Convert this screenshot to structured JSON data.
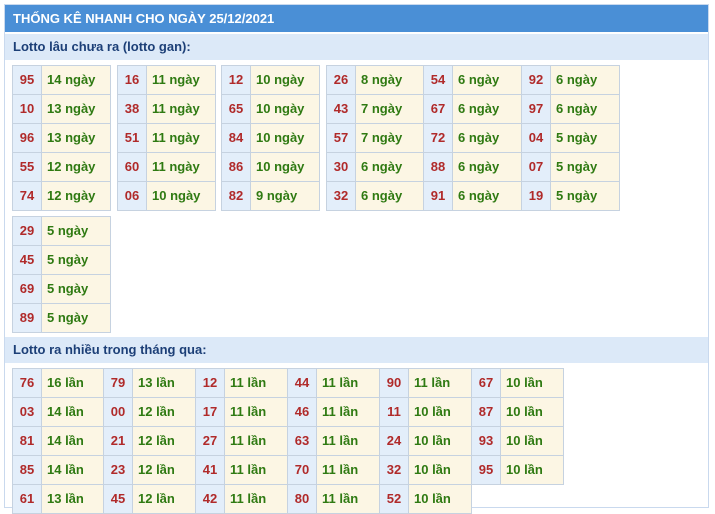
{
  "title": "THỐNG KÊ NHANH CHO NGÀY 25/12/2021",
  "sections": [
    {
      "heading": "Lotto lâu chưa ra (lotto gan):",
      "groups": [
        [
          {
            "n": "95",
            "v": "14 ngày"
          },
          {
            "n": "10",
            "v": "13 ngày"
          },
          {
            "n": "96",
            "v": "13 ngày"
          },
          {
            "n": "55",
            "v": "12 ngày"
          },
          {
            "n": "74",
            "v": "12 ngày"
          }
        ],
        [
          {
            "n": "16",
            "v": "11 ngày"
          },
          {
            "n": "38",
            "v": "11 ngày"
          },
          {
            "n": "51",
            "v": "11 ngày"
          },
          {
            "n": "60",
            "v": "11 ngày"
          },
          {
            "n": "06",
            "v": "10 ngày"
          }
        ],
        [
          {
            "n": "12",
            "v": "10 ngày"
          },
          {
            "n": "65",
            "v": "10 ngày"
          },
          {
            "n": "84",
            "v": "10 ngày"
          },
          {
            "n": "86",
            "v": "10 ngày"
          },
          {
            "n": "82",
            "v": "9 ngày"
          }
        ],
        [
          {
            "n": "26",
            "v": "8 ngày"
          },
          {
            "n": "43",
            "v": "7 ngày"
          },
          {
            "n": "57",
            "v": "7 ngày"
          },
          {
            "n": "30",
            "v": "6 ngày"
          },
          {
            "n": "32",
            "v": "6 ngày"
          }
        ],
        [
          {
            "n": "54",
            "v": "6 ngày"
          },
          {
            "n": "67",
            "v": "6 ngày"
          },
          {
            "n": "72",
            "v": "6 ngày"
          },
          {
            "n": "88",
            "v": "6 ngày"
          },
          {
            "n": "91",
            "v": "6 ngày"
          }
        ],
        [
          {
            "n": "92",
            "v": "6 ngày"
          },
          {
            "n": "97",
            "v": "6 ngày"
          },
          {
            "n": "04",
            "v": "5 ngày"
          },
          {
            "n": "07",
            "v": "5 ngày"
          },
          {
            "n": "19",
            "v": "5 ngày"
          }
        ],
        [
          {
            "n": "29",
            "v": "5 ngày"
          },
          {
            "n": "45",
            "v": "5 ngày"
          },
          {
            "n": "69",
            "v": "5 ngày"
          },
          {
            "n": "89",
            "v": "5 ngày"
          }
        ]
      ]
    },
    {
      "heading": "Lotto ra nhiều trong tháng qua:",
      "groups": [
        [
          {
            "n": "76",
            "v": "16 lần"
          },
          {
            "n": "03",
            "v": "14 lần"
          },
          {
            "n": "81",
            "v": "14 lần"
          },
          {
            "n": "85",
            "v": "14 lần"
          },
          {
            "n": "61",
            "v": "13 lần"
          }
        ],
        [
          {
            "n": "79",
            "v": "13 lần"
          },
          {
            "n": "00",
            "v": "12 lần"
          },
          {
            "n": "21",
            "v": "12 lần"
          },
          {
            "n": "23",
            "v": "12 lần"
          },
          {
            "n": "45",
            "v": "12 lần"
          }
        ],
        [
          {
            "n": "12",
            "v": "11 lần"
          },
          {
            "n": "17",
            "v": "11 lần"
          },
          {
            "n": "27",
            "v": "11 lần"
          },
          {
            "n": "41",
            "v": "11 lần"
          },
          {
            "n": "42",
            "v": "11 lần"
          }
        ],
        [
          {
            "n": "44",
            "v": "11 lần"
          },
          {
            "n": "46",
            "v": "11 lần"
          },
          {
            "n": "63",
            "v": "11 lần"
          },
          {
            "n": "70",
            "v": "11 lần"
          },
          {
            "n": "80",
            "v": "11 lần"
          }
        ],
        [
          {
            "n": "90",
            "v": "11 lần"
          },
          {
            "n": "11",
            "v": "10 lần"
          },
          {
            "n": "24",
            "v": "10 lần"
          },
          {
            "n": "32",
            "v": "10 lần"
          },
          {
            "n": "52",
            "v": "10 lần"
          }
        ],
        [
          {
            "n": "67",
            "v": "10 lần"
          },
          {
            "n": "87",
            "v": "10 lần"
          },
          {
            "n": "93",
            "v": "10 lần"
          },
          {
            "n": "95",
            "v": "10 lần"
          }
        ]
      ]
    }
  ]
}
